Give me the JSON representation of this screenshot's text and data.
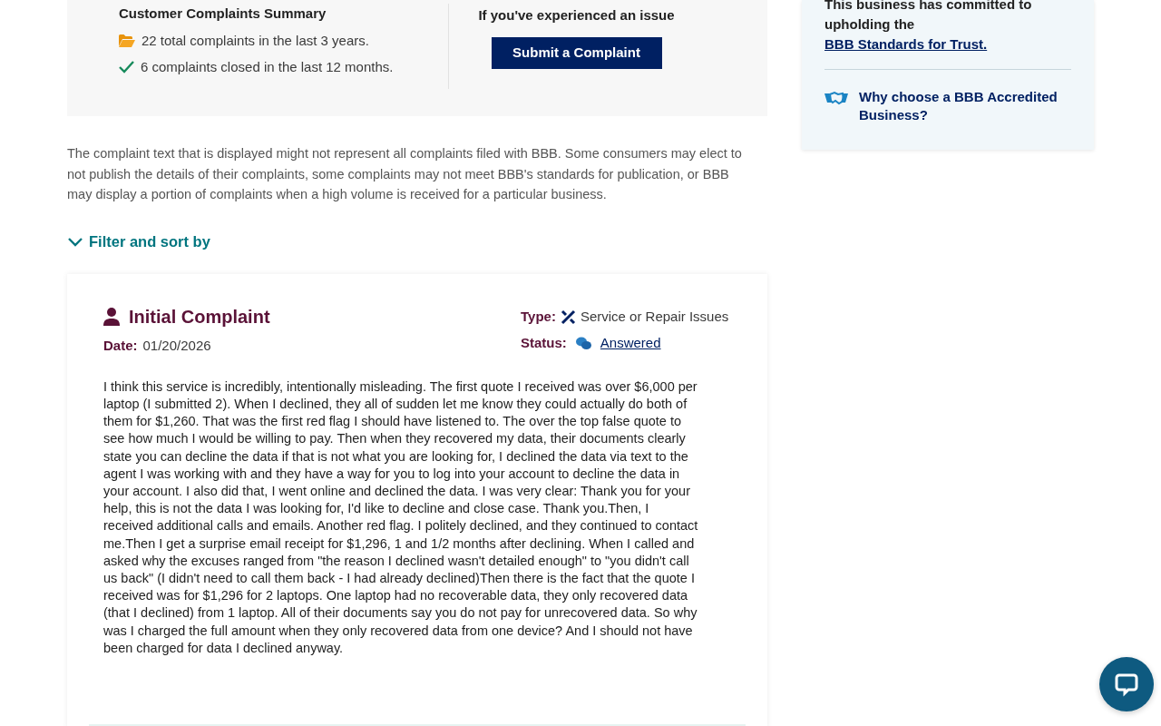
{
  "summary": {
    "title": "Customer Complaints Summary",
    "stats": [
      {
        "kind": "folder",
        "text": "22 total complaints in the last 3 years."
      },
      {
        "kind": "check",
        "text": "6 complaints closed in the last 12 months."
      }
    ],
    "cta_heading": "If you've experienced an issue",
    "cta_button": "Submit a Complaint"
  },
  "sidebar": {
    "commitment_text": "This business has committed to upholding the",
    "commitment_link": "BBB Standards for Trust.",
    "why_link": "Why choose a BBB Accredited Business?"
  },
  "disclaimer": "The complaint text that is displayed might not represent all complaints filed with BBB. Some consumers may elect to not publish the details of their complaints, some complaints may not meet BBB's standards for publication, or BBB may display a portion of complaints when a high volume is received for a particular business.",
  "filter": {
    "label": "Filter and sort by",
    "expanded": false
  },
  "complaint": {
    "title": "Initial Complaint",
    "date_label": "Date:",
    "date": "01/20/2026",
    "type_label": "Type:",
    "type": "Service or Repair Issues",
    "status_label": "Status:",
    "status": "Answered",
    "text": "I think this service is incredibly, intentionally misleading. The first quote I received was over $6,000 per laptop (I submitted 2). When I declined, they all of sudden let me know they could actually do both of them for $1,260. That was the first red flag I should have listened to. The over the top false quote to see how much I would be willing to pay. Then when they recovered my data, their documents clearly state you can decline the data if that is not what you are looking for, I declined the data via text to the agent I was working with and they have a way for you to log into your account to decline the data in your account. I also did that, I went online and declined the data. I was very clear: Thank you for your help, this is not the data I was looking for, I'd like to decline and close case. Thank you.Then, I received additional calls and emails. Another red flag. I politely declined, and they continued to contact me.Then I get a surprise email receipt for $1,296, 1 and 1/2 months after declining. When I called and asked why the excuses ranged from \"the reason I declined wasn't detailed enough\" to \"you didn't call us back\" (I didn't need to call them back - I had already declined)Then there is the fact that the quote I received was for $1,296 for 2 laptops. One laptop had no recoverable data, they only recovered data (that I declined) from 1 laptop. All of their documents say you do not pay for unrecovered data. So why was I charged the full amount when they only recovered data from one device? And I should not have been charged for data I declined anyway."
  }
}
